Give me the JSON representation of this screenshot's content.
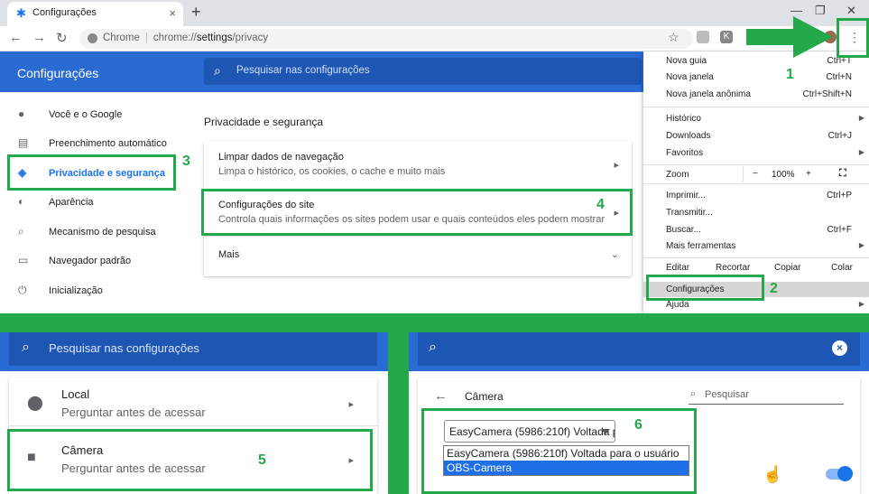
{
  "browser": {
    "tab_title": "Configurações",
    "tab_close": "×",
    "new_tab": "+",
    "window_min": "—",
    "window_restore": "❐",
    "window_close": "✕",
    "omnibox_site": "Chrome",
    "omnibox_sep": "|",
    "omnibox_scheme": "chrome://",
    "omnibox_host": "settings",
    "omnibox_path": "/privacy",
    "ext_k": "K",
    "menu_dots": "⋮"
  },
  "settings": {
    "title": "Configurações",
    "search_placeholder": "Pesquisar nas configurações",
    "sidebar": [
      {
        "label": "Você e o Google",
        "icon": "person-icon"
      },
      {
        "label": "Preenchimento automático",
        "icon": "clipboard-icon"
      },
      {
        "label": "Privacidade e segurança",
        "icon": "shield-icon"
      },
      {
        "label": "Aparência",
        "icon": "palette-icon"
      },
      {
        "label": "Mecanismo de pesquisa",
        "icon": "search-icon"
      },
      {
        "label": "Navegador padrão",
        "icon": "browser-icon"
      },
      {
        "label": "Inicialização",
        "icon": "power-icon"
      }
    ],
    "section_title": "Privacidade e segurança",
    "rows": [
      {
        "title": "Limpar dados de navegação",
        "sub": "Limpa o histórico, os cookies, o cache e muito mais"
      },
      {
        "title": "Configurações do site",
        "sub": "Controla quais informações os sites podem usar e quais conteúdos eles podem mostrar"
      },
      {
        "title": "Mais",
        "sub": ""
      }
    ]
  },
  "menu": {
    "items_top": [
      {
        "label": "Nova guia",
        "shortcut": "Ctrl+T"
      },
      {
        "label": "Nova janela",
        "shortcut": "Ctrl+N"
      },
      {
        "label": "Nova janela anônima",
        "shortcut": "Ctrl+Shift+N"
      }
    ],
    "items_mid": [
      {
        "label": "Histórico",
        "shortcut": ""
      },
      {
        "label": "Downloads",
        "shortcut": "Ctrl+J"
      },
      {
        "label": "Favoritos",
        "shortcut": ""
      }
    ],
    "zoom_label": "Zoom",
    "zoom_minus": "−",
    "zoom_value": "100%",
    "zoom_plus": "+",
    "items_tools": [
      {
        "label": "Imprimir...",
        "shortcut": "Ctrl+P"
      },
      {
        "label": "Transmitir...",
        "shortcut": ""
      },
      {
        "label": "Buscar...",
        "shortcut": "Ctrl+F"
      },
      {
        "label": "Mais ferramentas",
        "shortcut": ""
      }
    ],
    "edit_label": "Editar",
    "edit_cut": "Recortar",
    "edit_copy": "Copiar",
    "edit_paste": "Colar",
    "settings_label": "Configurações",
    "help_label": "Ajuda"
  },
  "annotations": {
    "n1": "1",
    "n2": "2",
    "n3": "3",
    "n4": "4",
    "n5": "5",
    "n6": "6"
  },
  "site_settings": {
    "search_placeholder": "Pesquisar nas configurações",
    "rows": [
      {
        "title": "Local",
        "sub": "Perguntar antes de acessar",
        "icon": "location-pin-icon"
      },
      {
        "title": "Câmera",
        "sub": "Perguntar antes de acessar",
        "icon": "camera-icon"
      }
    ]
  },
  "camera": {
    "title": "Câmera",
    "search_placeholder": "Pesquisar",
    "selected": "EasyCamera (5986:210f) Voltada para o usuário",
    "options": [
      "EasyCamera (5986:210f) Voltada para o usuário",
      "OBS-Camera"
    ],
    "selected_option_index": 1,
    "toggle_on": true
  }
}
